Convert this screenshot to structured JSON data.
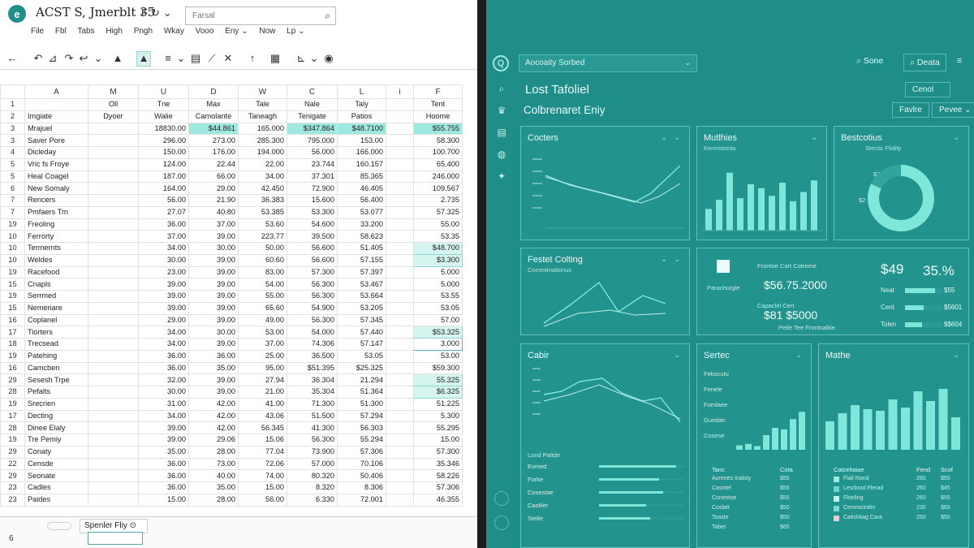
{
  "spreadsheet": {
    "title": "ACST  S, Jmerblt 35",
    "title_icons": [
      "F",
      "↻",
      "⌄"
    ],
    "search_placeholder": "Farsal",
    "menu": [
      "File",
      "Fbl",
      "Tabs",
      "High",
      "Pngh",
      "Wkay",
      "Vooo",
      "Eny ⌄",
      "Now",
      "Lp ⌄"
    ],
    "toolbar": [
      "←",
      "↶",
      "⊿",
      "↷",
      "↩",
      "⌄",
      "▲",
      "≡",
      "⌄",
      "▤",
      "⟋",
      "✕",
      "↑",
      "▦",
      "⊾",
      "⌄",
      "◉"
    ],
    "columns": [
      "A",
      "M",
      "U",
      "D",
      "W",
      "C",
      "L",
      "i",
      "F"
    ],
    "header_rows": [
      [
        "1",
        "",
        "Oll",
        "Tne",
        "Max",
        "Tale",
        "Nale",
        "Taly",
        "",
        "Tent"
      ],
      [
        "2",
        "Imgiate",
        "Dyoer",
        "Walie",
        "Camolante",
        "Taneagh",
        "Tenigate",
        "Patios",
        "",
        "Hoome"
      ]
    ],
    "rows": [
      [
        "3",
        "Mrajuel",
        "",
        "18830.00",
        "$44.861",
        "165.000",
        "$347.864",
        "$48.7100",
        "",
        "$55.755"
      ],
      [
        "3",
        "Saver Pore",
        "",
        "296.00",
        "273.00",
        "285.300",
        "795.000",
        "153.00",
        "",
        "58.300"
      ],
      [
        "4",
        "Dicleday",
        "",
        "150.00",
        "176.00",
        "194.000",
        "56.000",
        "166.000",
        "",
        "100.700"
      ],
      [
        "5",
        "Vric fs Froye",
        "",
        "124.00",
        "22.44",
        "22.00",
        "23.744",
        "160.157",
        "",
        "65.400"
      ],
      [
        "5",
        "Heal Coagel",
        "",
        "187.00",
        "66.00",
        "34.00",
        "37.301",
        "85.365",
        "",
        "246.000"
      ],
      [
        "6",
        "New Somaly",
        "",
        "164.00",
        "29.00",
        "42.450",
        "72.900",
        "46.405",
        "",
        "109.567"
      ],
      [
        "7",
        "Rencers",
        "",
        "56.00",
        "21.90",
        "36.383",
        "15.600",
        "56.400",
        "",
        "2.735"
      ],
      [
        "7",
        "Pmfaers Trn",
        "",
        "27.07",
        "40.80",
        "53.385",
        "53.300",
        "53.077",
        "",
        "57.325"
      ],
      [
        "19",
        "Freoling",
        "",
        "36.00",
        "37.00",
        "53.60",
        "54.600",
        "33.200",
        "",
        "55.00"
      ],
      [
        "10",
        "Ferrorty",
        "",
        "37.00",
        "39.00",
        "223.77",
        "39.500",
        "58.623",
        "",
        "53.35"
      ],
      [
        "10",
        "Termernts",
        "",
        "34.00",
        "30.00",
        "50.00",
        "56.600",
        "51.405",
        "",
        "$48.700"
      ],
      [
        "10",
        "Weldes",
        "",
        "30.00",
        "39.00",
        "60.60",
        "56.600",
        "57.155",
        "",
        "$3.300"
      ],
      [
        "19",
        "Racefood",
        "",
        "23.00",
        "39.00",
        "83.00",
        "57.300",
        "57.397",
        "",
        "5.000"
      ],
      [
        "15",
        "Cnapls",
        "",
        "39.00",
        "39.00",
        "54.00",
        "56.300",
        "53.467",
        "",
        "5.000"
      ],
      [
        "19",
        "Serrmed",
        "",
        "39.00",
        "39.00",
        "55.00",
        "56.300",
        "53.664",
        "",
        "53.55"
      ],
      [
        "15",
        "Nemeriare",
        "",
        "39.00",
        "39.00",
        "65.60",
        "54.900",
        "53.205",
        "",
        "53.05"
      ],
      [
        "16",
        "Coplanel",
        "",
        "29.00",
        "39.00",
        "49.00",
        "56.300",
        "57.345",
        "",
        "57.00"
      ],
      [
        "17",
        "Tiorters",
        "",
        "34.00",
        "30.00",
        "53.00",
        "54.000",
        "57.440",
        "",
        "$53.325"
      ],
      [
        "18",
        "Trecsead",
        "",
        "34.00",
        "39.00",
        "37.00",
        "74.306",
        "57.147",
        "",
        "3.000"
      ],
      [
        "19",
        "Patehing",
        "",
        "36.00",
        "36.00",
        "25.00",
        "36.500",
        "53.05",
        "",
        "53.00"
      ],
      [
        "16",
        "Camcben",
        "",
        "36.00",
        "35.00",
        "95.00",
        "$51.395",
        "$25.325",
        "",
        "$59.300"
      ],
      [
        "29",
        "Sesesh  Trpe",
        "",
        "32.00",
        "39.00",
        "27.94",
        "36.304",
        "21.294",
        "",
        "55.325"
      ],
      [
        "28",
        "Pefalts",
        "",
        "30.00",
        "39.00",
        "21.00",
        "35.304",
        "51.364",
        "",
        "$6.325"
      ],
      [
        "19",
        "Srecrien",
        "",
        "31.00",
        "42.00",
        "41.00",
        "71.300",
        "51.300",
        "",
        "51.225"
      ],
      [
        "17",
        "Decting",
        "",
        "34.00",
        "42.00",
        "43.06",
        "51.500",
        "57.294",
        "",
        "5.300"
      ],
      [
        "28",
        "Dinee Elaly",
        "",
        "39.00",
        "42.00",
        "56.345",
        "41.300",
        "56.303",
        "",
        "55.295"
      ],
      [
        "19",
        "Tre Pemiy",
        "",
        "39.00",
        "29.06",
        "15.06",
        "56.300",
        "55.294",
        "",
        "15.00"
      ],
      [
        "29",
        "Conaty",
        "",
        "35.00",
        "28.00",
        "77.04",
        "73.900",
        "57.306",
        "",
        "57.300"
      ],
      [
        "22",
        "Censde",
        "",
        "36.00",
        "73.00",
        "72.06",
        "57.000",
        "70.106",
        "",
        "35.346"
      ],
      [
        "29",
        "Seonate",
        "",
        "36.00",
        "40.00",
        "74.00",
        "80.320",
        "50.406",
        "",
        "58.226"
      ],
      [
        "23",
        "Cadles",
        "",
        "36.00",
        "35.00",
        "15.00",
        "8.320",
        "8.306",
        "",
        "57.306"
      ],
      [
        "23",
        "Paides",
        "",
        "15.00",
        "28.00",
        "56.00",
        "6.330",
        "72.001",
        "",
        "46.355"
      ]
    ],
    "highlight_cells": {
      "strong": [
        "0-4",
        "0-6",
        "0-7",
        "0-9"
      ],
      "soft": [
        "10-9",
        "11-9",
        "17-9",
        "21-9",
        "22-9"
      ],
      "selected": [
        "18-9"
      ]
    },
    "sheet_tab_label": "Spenler Fliy ⊙",
    "status_row_label": "6"
  },
  "dashboard": {
    "logo": "Q",
    "dropdown_label": "Aocoaity Sorbed",
    "search_label": "Sone",
    "search2_label": "Deata",
    "header_title": "Lost Tafoliel",
    "header_sub": "Colbrenaret Eniy",
    "cancel_label": "Cenol",
    "btn_a": "Favlre",
    "btn_b": "Pevee ⌄",
    "cards": {
      "costers": {
        "title": "Cocters",
        "ticks": [
          "—",
          "—",
          "—",
          "—",
          "—"
        ]
      },
      "muthies": {
        "title": "Mutlhies",
        "subtitle": "Kennistonia",
        "bars": [
          0.28,
          0.4,
          0.75,
          0.42,
          0.6,
          0.55,
          0.45,
          0.62,
          0.38,
          0.5,
          0.65
        ]
      },
      "beststrits": {
        "title": "Bestcotius",
        "subtitle": "Stectic Flidity",
        "donut_fraction": 0.82,
        "labels": [
          "$75",
          "$2"
        ]
      },
      "festet": {
        "title": "Festet Colting",
        "subtitle": "Commimationus"
      },
      "stats": {
        "label1": "Frontoe Cart Cotreme",
        "value1": "$56.75.2000",
        "label2": "Capaclel Cert",
        "value2": "$81 $5000",
        "small_text": "Petle Tee Frontsalitie",
        "icon_caption": "Parachurgle",
        "big1": "$49",
        "big2": "35.%",
        "rows": [
          {
            "label": "Neat",
            "value": "$55",
            "fill": 0.8
          },
          {
            "label": "Cent",
            "value": "$5601",
            "fill": 0.5
          },
          {
            "label": "Tolen",
            "value": "$$604",
            "fill": 0.45
          }
        ]
      },
      "cabir": {
        "title": "Cabir",
        "table_header": "Lond Paltde",
        "rows": [
          {
            "label": "Esmed",
            "fill": 0.9
          },
          {
            "label": "Forke",
            "fill": 0.7
          },
          {
            "label": "Cosestae",
            "fill": 0.75
          },
          {
            "label": "Caoliler",
            "fill": 0.55
          },
          {
            "label": "Stelte",
            "fill": 0.6
          }
        ]
      },
      "series": {
        "title": "Sertec",
        "labels": [
          "Fekocutu",
          "Fenele",
          "Fomlaee",
          "Guedan",
          "Cosese"
        ],
        "bars": [
          0.06,
          0.08,
          0.05,
          0.2,
          0.3,
          0.28,
          0.42,
          0.52
        ],
        "table": {
          "headers": [
            "Tanc",
            "Cota"
          ],
          "rows": [
            [
              "Aurenes Inalsty",
              "$55"
            ],
            [
              "Casntel",
              "$55"
            ],
            [
              "Coneotoe",
              "$55"
            ],
            [
              "Coslatt",
              "$50"
            ],
            [
              "Toaste",
              "$50"
            ],
            [
              "Tabet",
              "$65"
            ]
          ]
        }
      },
      "mathe": {
        "title": "Mathe",
        "bars": [
          0.35,
          0.45,
          0.55,
          0.5,
          0.48,
          0.62,
          0.52,
          0.72,
          0.6,
          0.75,
          0.4
        ],
        "table": {
          "headers": [
            "Catceltaiae",
            "Fend",
            "Scof"
          ],
          "rows": [
            [
              "Flail Rand",
              "260",
              "$50",
              "#9fe8e0"
            ],
            [
              "Lesrbrad Flerad",
              "260",
              "$45",
              "#6fd4c8"
            ],
            [
              "Fkteling",
              "260",
              "$55",
              "#c8f0eb"
            ],
            [
              "Cemrocinttin",
              "230",
              "$65",
              "#7fd7cc"
            ],
            [
              "Catishliag Cara",
              "250",
              "$50",
              "#f3c9cf"
            ]
          ]
        }
      }
    }
  },
  "colors": {
    "accent": "#7fe6da",
    "dash_bg": "#1f8d88",
    "card_border": "#62c0b8",
    "highlight": "#9fe8e0"
  }
}
